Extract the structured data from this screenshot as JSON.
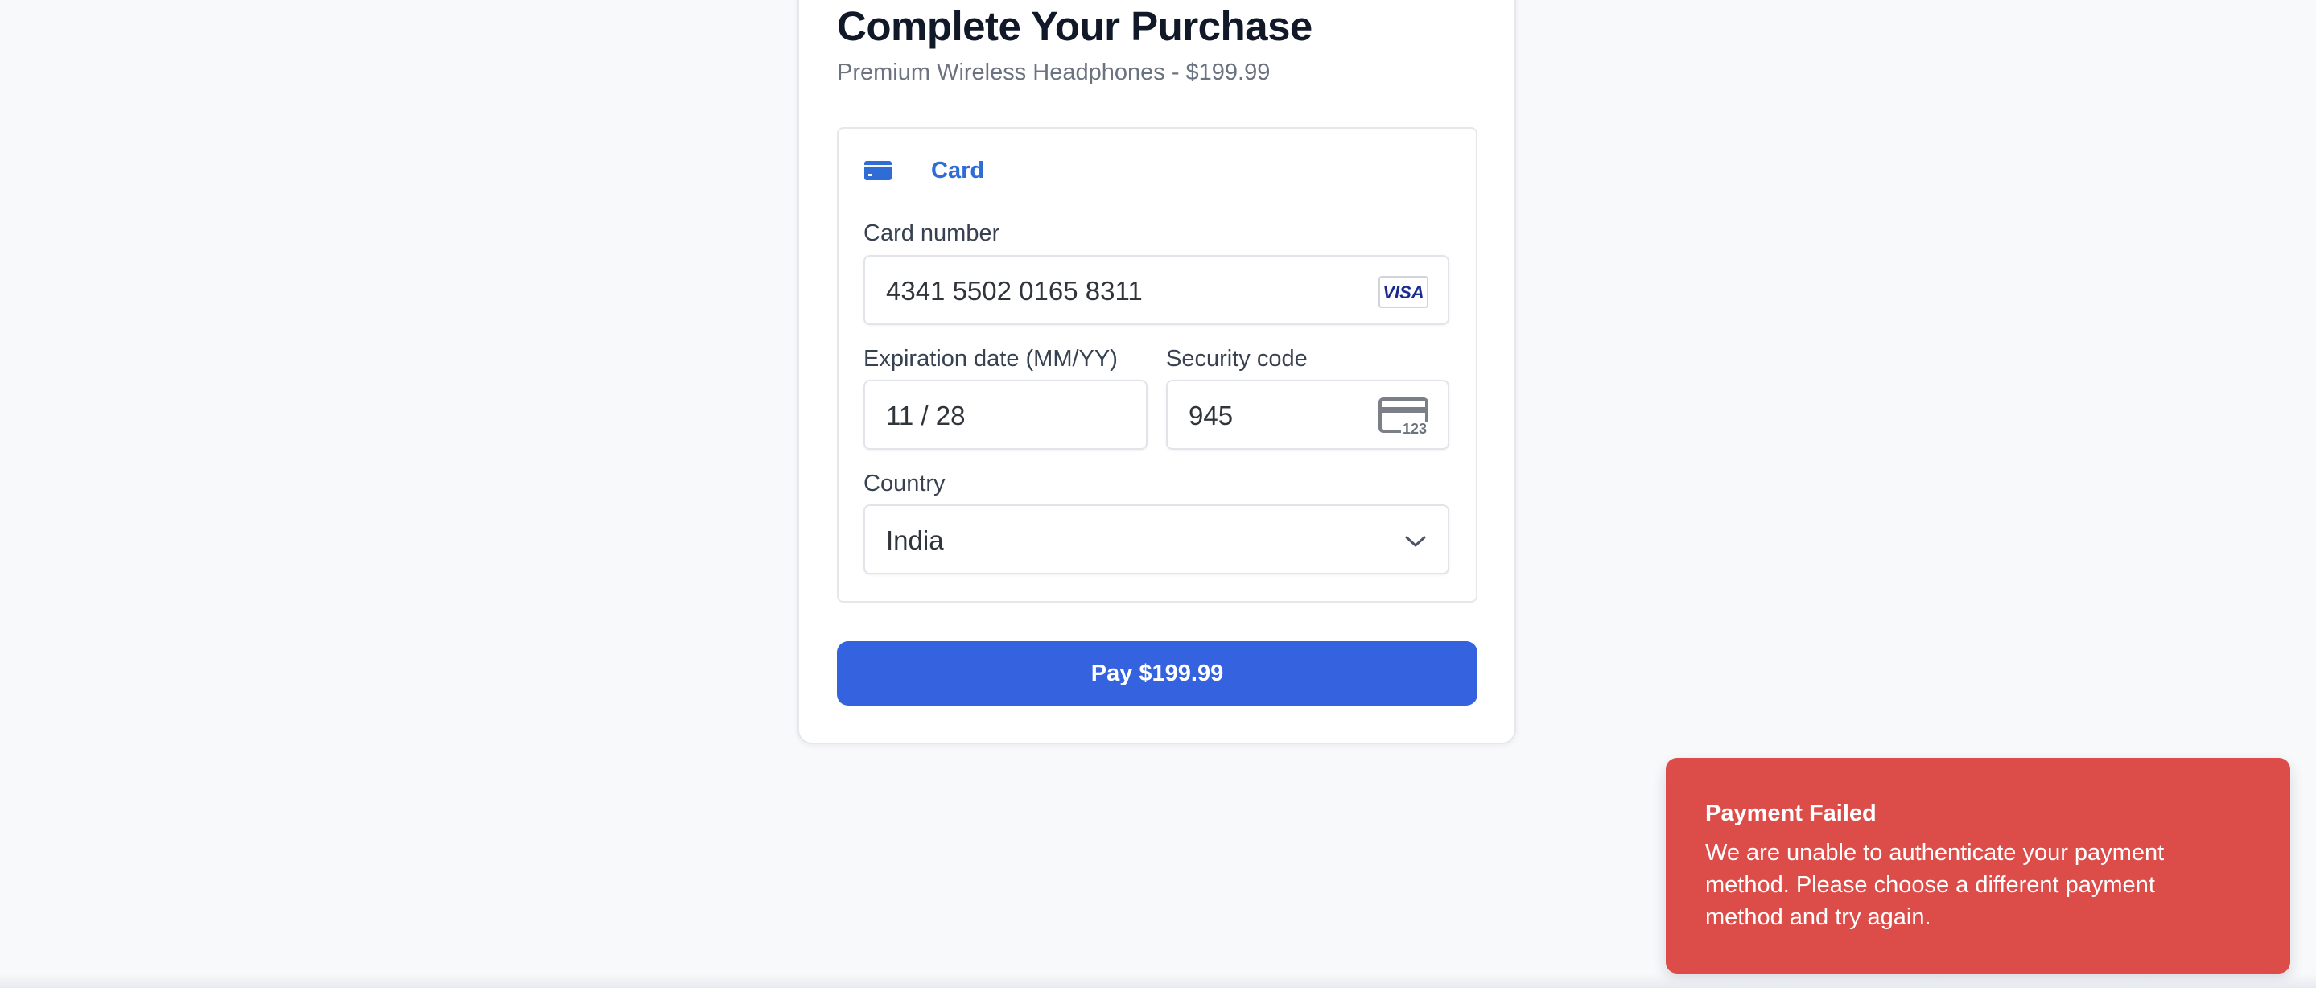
{
  "checkout": {
    "title": "Complete Your Purchase",
    "subtitle": "Premium Wireless Headphones - $199.99",
    "method": {
      "label": "Card",
      "icon": "credit-card-icon"
    },
    "fields": {
      "card_number": {
        "label": "Card number",
        "value": "4341 5502 0165 8311",
        "brand": "VISA",
        "brand_icon": "visa-logo-icon"
      },
      "expiration": {
        "label": "Expiration date (MM/YY)",
        "value": "11 / 28"
      },
      "security_code": {
        "label": "Security code",
        "value": "945",
        "icon": "cvc-card-icon",
        "icon_text": "123"
      },
      "country": {
        "label": "Country",
        "value": "India",
        "icon": "chevron-down-icon"
      }
    },
    "pay_button": {
      "label": "Pay $199.99"
    }
  },
  "toast": {
    "title": "Payment Failed",
    "message": "We are unable to authenticate your payment method. Please choose a different payment method and try again."
  },
  "colors": {
    "page_background": "#f8f9fb",
    "accent": "#3563e0",
    "method_accent": "#2f6cd6",
    "error": "#dc4d4a",
    "visa_blue": "#1a2b8f"
  }
}
